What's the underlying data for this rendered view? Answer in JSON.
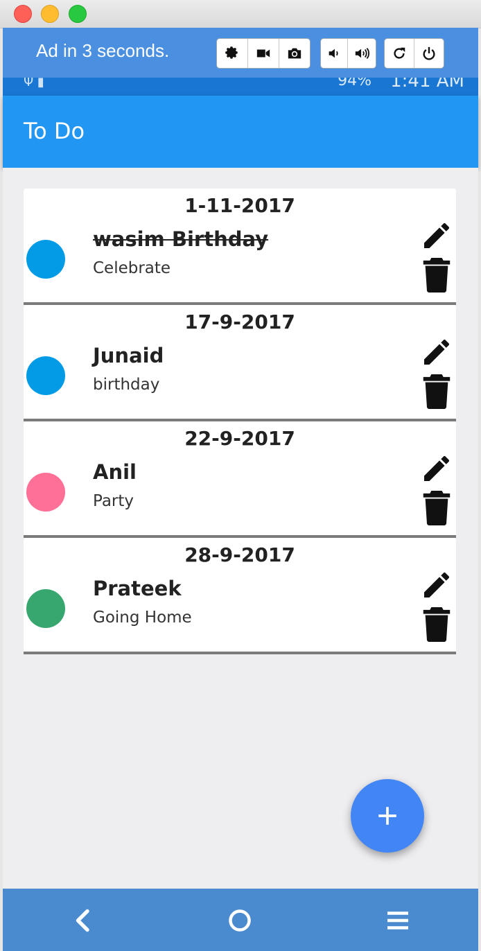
{
  "ad_bar": {
    "text": "Ad in 3 seconds.",
    "groups": [
      [
        "gear-icon",
        "video-camera-icon",
        "camera-icon"
      ],
      [
        "volume-down-icon",
        "volume-up-icon"
      ],
      [
        "rotate-icon",
        "power-icon"
      ]
    ]
  },
  "status_bar": {
    "time": "1:41 AM",
    "battery": "94%"
  },
  "app_bar": {
    "title": "To Do"
  },
  "todos": [
    {
      "date": "1-11-2017",
      "name": "wasim Birthday",
      "description": "Celebrate",
      "color": "#039be5",
      "completed": true
    },
    {
      "date": "17-9-2017",
      "name": "Junaid",
      "description": "birthday",
      "color": "#039be5",
      "completed": false
    },
    {
      "date": "22-9-2017",
      "name": "Anil",
      "description": "Party",
      "color": "#ff7096",
      "completed": false
    },
    {
      "date": "28-9-2017",
      "name": "Prateek",
      "description": "Going Home",
      "color": "#37a66f",
      "completed": false
    }
  ],
  "fab": {
    "icon": "plus-icon",
    "color": "#4285f4"
  },
  "nav_bar": {
    "buttons": [
      "back-icon",
      "home-icon",
      "menu-icon"
    ]
  },
  "colors": {
    "app_bar": "#2196f3",
    "status_bar": "#1976d2",
    "ad_bar": "#4a8fe0",
    "nav_bar": "#4a8bd0"
  }
}
